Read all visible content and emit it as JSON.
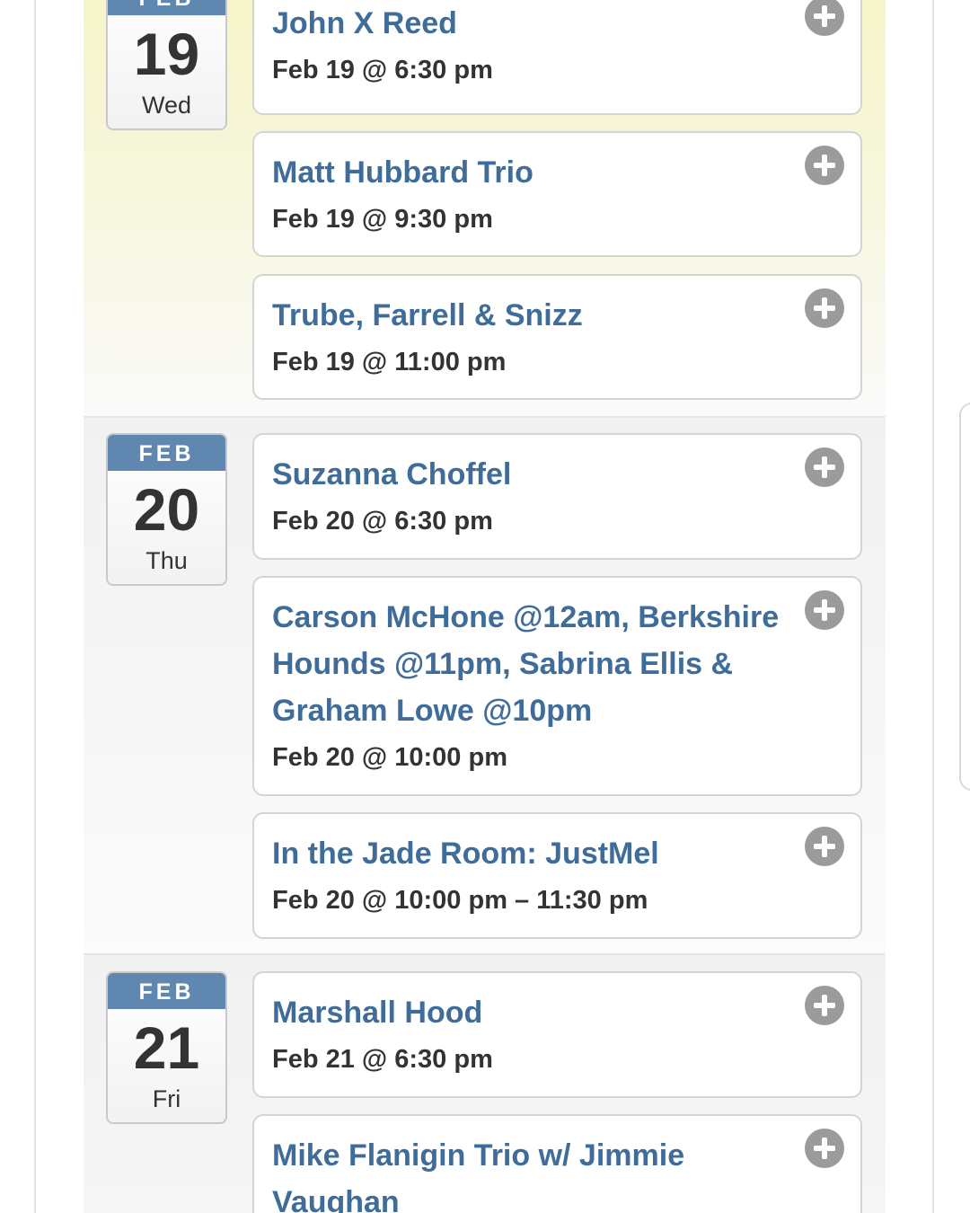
{
  "days": [
    {
      "month": "FEB",
      "day": "19",
      "weekday": "Wed",
      "events": [
        {
          "title": "John X Reed",
          "time": "Feb 19 @ 6:30 pm"
        },
        {
          "title": "Matt Hubbard Trio",
          "time": "Feb 19 @ 9:30 pm"
        },
        {
          "title": "Trube, Farrell & Snizz",
          "time": "Feb 19 @ 11:00 pm"
        }
      ]
    },
    {
      "month": "FEB",
      "day": "20",
      "weekday": "Thu",
      "events": [
        {
          "title": "Suzanna Choffel",
          "time": "Feb 20 @ 6:30 pm"
        },
        {
          "title": "Carson McHone @12am, Berkshire Hounds @11pm, Sabrina Ellis & Graham Lowe @10pm",
          "time": "Feb 20 @ 10:00 pm"
        },
        {
          "title": "In the Jade Room: JustMel",
          "time": "Feb 20 @ 10:00 pm – 11:30 pm"
        }
      ]
    },
    {
      "month": "FEB",
      "day": "21",
      "weekday": "Fri",
      "events": [
        {
          "title": "Marshall Hood",
          "time": "Feb 21 @ 6:30 pm"
        },
        {
          "title": "Mike Flanigin Trio w/ Jimmie Vaughan",
          "time": ""
        }
      ]
    }
  ],
  "colors": {
    "month_band": "#5f87af",
    "event_title": "#3f6c99",
    "today_highlight": "#f5f5c9",
    "add_icon": "#9b9b9b"
  },
  "icons": {
    "add": "plus-circle-icon"
  }
}
